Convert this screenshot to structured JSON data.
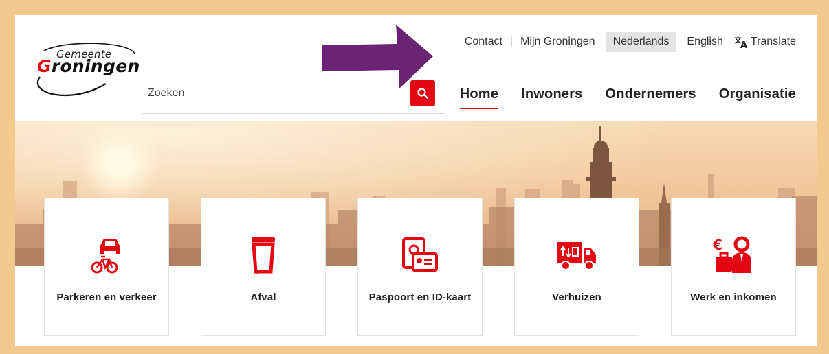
{
  "logo": {
    "small": "Gemeente",
    "big": "Groningen"
  },
  "topnav": {
    "contact": "Contact",
    "separator": "|",
    "mijn": "Mijn Groningen",
    "nederlands": "Nederlands",
    "english": "English",
    "translate": "Translate"
  },
  "search": {
    "placeholder": "Zoeken"
  },
  "mainnav": [
    "Home",
    "Inwoners",
    "Ondernemers",
    "Organisatie"
  ],
  "cards": [
    {
      "label": "Parkeren en verkeer",
      "icon": "car-bike-icon"
    },
    {
      "label": "Afval",
      "icon": "trash-bin-icon"
    },
    {
      "label": "Paspoort en ID-kaart",
      "icon": "passport-id-icon"
    },
    {
      "label": "Verhuizen",
      "icon": "moving-truck-icon"
    },
    {
      "label": "Werk en inkomen",
      "icon": "work-income-icon"
    }
  ],
  "colors": {
    "brand_red": "#e30613",
    "frame": "#f3c98f",
    "arrow": "#6b2474",
    "active_lang_bg": "#e4e4e4"
  }
}
